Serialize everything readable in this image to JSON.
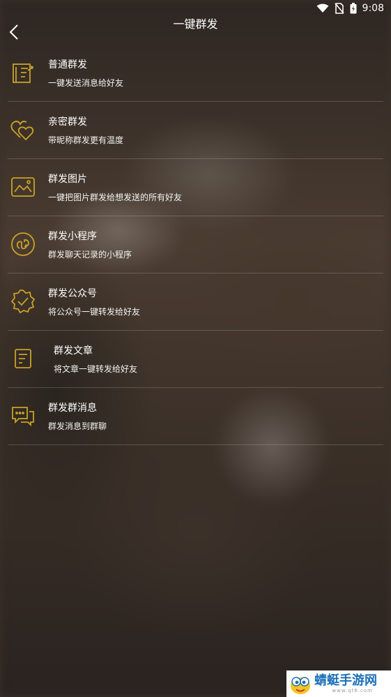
{
  "status_bar": {
    "time": "9:08"
  },
  "header": {
    "title": "一键群发"
  },
  "items": [
    {
      "name": "普通群发",
      "desc": "一键发送消息给好友",
      "icon": "compose-icon"
    },
    {
      "name": "亲密群发",
      "desc": "带昵称群发更有温度",
      "icon": "hearts-icon"
    },
    {
      "name": "群发图片",
      "desc": "一键把图片群发给想发送的所有好友",
      "icon": "image-icon"
    },
    {
      "name": "群发小程序",
      "desc": "群发聊天记录的小程序",
      "icon": "mini-program-icon"
    },
    {
      "name": "群发公众号",
      "desc": "将公众号一键转发给好友",
      "icon": "verified-badge-icon"
    },
    {
      "name": "群发文章",
      "desc": "将文章一键转发给好友",
      "icon": "article-icon"
    },
    {
      "name": "群发群消息",
      "desc": "群发消息到群聊",
      "icon": "chat-bubbles-icon"
    }
  ],
  "watermark": {
    "brand": "蜻蜓手游网",
    "domain": "www.qt6.com"
  },
  "colors": {
    "accent": "#c9a227",
    "divider": "rgba(255,255,255,0.18)"
  }
}
